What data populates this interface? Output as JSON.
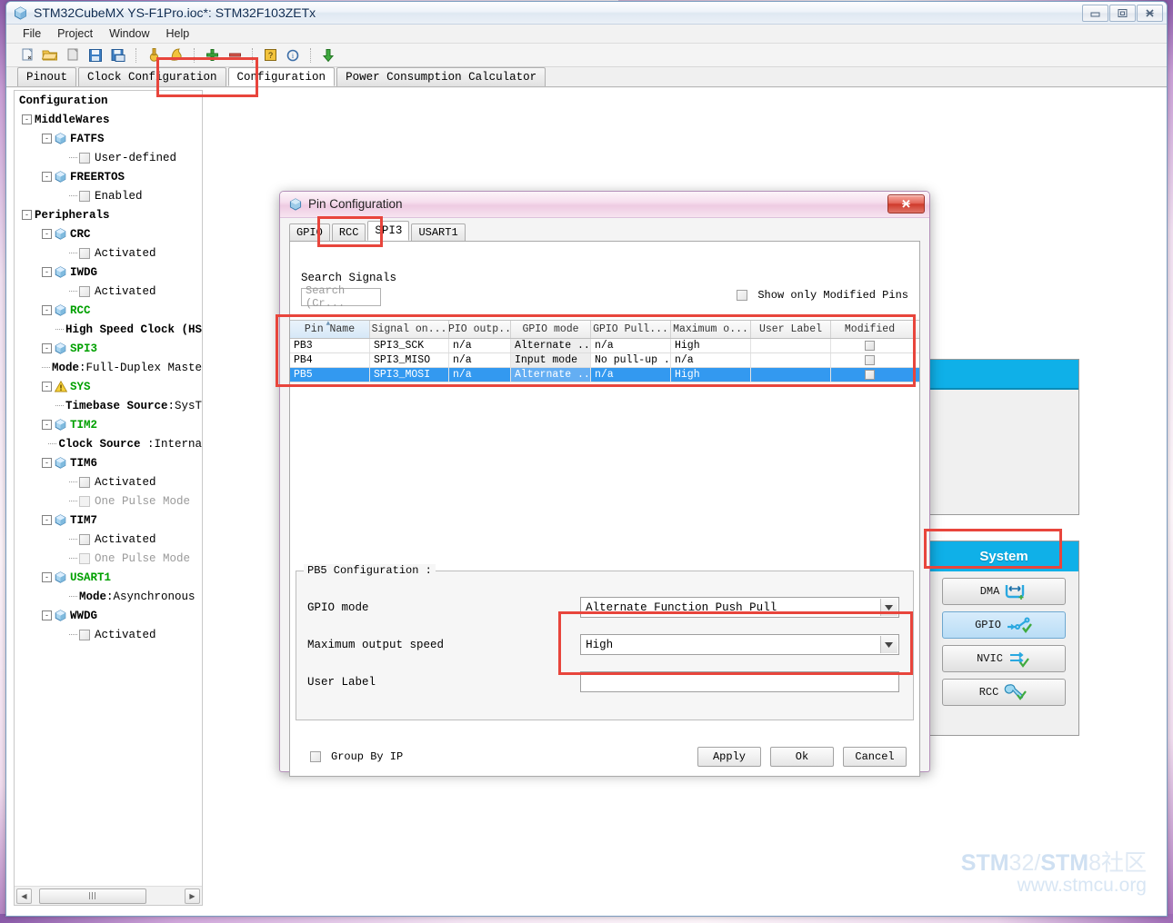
{
  "window": {
    "title": "STM32CubeMX YS-F1Pro.ioc*: STM32F103ZETx",
    "app_icon": "cube-icon",
    "controls": {
      "minimize": "minimize-icon",
      "maximize": "maximize-icon",
      "close": "close-icon"
    }
  },
  "menu": {
    "items": [
      "File",
      "Project",
      "Window",
      "Help"
    ]
  },
  "toolbar": {
    "buttons": [
      "new-project-icon",
      "open-project-icon",
      "copy-icon",
      "save-icon",
      "save-as-icon",
      "sep",
      "pin-icon",
      "generate-report-icon",
      "sep",
      "zoom-in-icon",
      "zoom-out-icon",
      "sep",
      "help-icon",
      "about-icon",
      "sep",
      "download-icon"
    ]
  },
  "main_tabs": {
    "items": [
      "Pinout",
      "Clock Configuration",
      "Configuration",
      "Power Consumption Calculator"
    ],
    "active": "Configuration"
  },
  "tree": {
    "title": "Configuration",
    "nodes": [
      {
        "id": "middlewares",
        "label": "MiddleWares",
        "indent": 8,
        "type": "group",
        "expander": "-"
      },
      {
        "id": "fatfs",
        "label": "FATFS",
        "indent": 30,
        "type": "peri",
        "expander": "-",
        "state": "normal"
      },
      {
        "id": "fatfs-ud",
        "label": "User-defined",
        "indent": 60,
        "type": "check",
        "checked": false,
        "enabled": true
      },
      {
        "id": "freertos",
        "label": "FREERTOS",
        "indent": 30,
        "type": "peri",
        "expander": "-",
        "state": "normal"
      },
      {
        "id": "freertos-en",
        "label": "Enabled",
        "indent": 60,
        "type": "check",
        "checked": false,
        "enabled": true
      },
      {
        "id": "peripherals",
        "label": "Peripherals",
        "indent": 8,
        "type": "group",
        "expander": "-"
      },
      {
        "id": "crc",
        "label": "CRC",
        "indent": 30,
        "type": "peri",
        "expander": "-",
        "state": "normal"
      },
      {
        "id": "crc-act",
        "label": "Activated",
        "indent": 60,
        "type": "check",
        "checked": false,
        "enabled": true
      },
      {
        "id": "iwdg",
        "label": "IWDG",
        "indent": 30,
        "type": "peri",
        "expander": "-",
        "state": "normal"
      },
      {
        "id": "iwdg-act",
        "label": "Activated",
        "indent": 60,
        "type": "check",
        "checked": false,
        "enabled": true
      },
      {
        "id": "rcc",
        "label": "RCC",
        "indent": 30,
        "type": "peri",
        "expander": "-",
        "state": "green"
      },
      {
        "id": "rcc-hs",
        "label": "High Speed Clock (HS",
        "indent": 60,
        "type": "sub"
      },
      {
        "id": "spi3",
        "label": "SPI3",
        "indent": 30,
        "type": "peri",
        "expander": "-",
        "state": "green"
      },
      {
        "id": "spi3-mode",
        "label": "Mode",
        "value": ":Full-Duplex Maste",
        "indent": 60,
        "type": "sub"
      },
      {
        "id": "sys",
        "label": "SYS",
        "indent": 30,
        "type": "warn",
        "expander": "-",
        "state": "green"
      },
      {
        "id": "sys-tb",
        "label": "Timebase Source",
        "value": ":SysT",
        "indent": 60,
        "type": "sub"
      },
      {
        "id": "tim2",
        "label": "TIM2",
        "indent": 30,
        "type": "peri",
        "expander": "-",
        "state": "green"
      },
      {
        "id": "tim2-clk",
        "label": "Clock Source",
        "value": " :Interna",
        "indent": 60,
        "type": "sub"
      },
      {
        "id": "tim6",
        "label": "TIM6",
        "indent": 30,
        "type": "peri",
        "expander": "-",
        "state": "normal"
      },
      {
        "id": "tim6-act",
        "label": "Activated",
        "indent": 60,
        "type": "check",
        "checked": false,
        "enabled": true
      },
      {
        "id": "tim6-opm",
        "label": "One Pulse Mode",
        "indent": 60,
        "type": "check",
        "checked": false,
        "enabled": false
      },
      {
        "id": "tim7",
        "label": "TIM7",
        "indent": 30,
        "type": "peri",
        "expander": "-",
        "state": "normal"
      },
      {
        "id": "tim7-act",
        "label": "Activated",
        "indent": 60,
        "type": "check",
        "checked": false,
        "enabled": true
      },
      {
        "id": "tim7-opm",
        "label": "One Pulse Mode",
        "indent": 60,
        "type": "check",
        "checked": false,
        "enabled": false
      },
      {
        "id": "usart1",
        "label": "USART1",
        "indent": 30,
        "type": "peri",
        "expander": "-",
        "state": "green"
      },
      {
        "id": "usart1-mode",
        "label": "Mode",
        "value": ":Asynchronous",
        "indent": 60,
        "type": "sub"
      },
      {
        "id": "wwdg",
        "label": "WWDG",
        "indent": 30,
        "type": "peri",
        "expander": "-",
        "state": "normal"
      },
      {
        "id": "wwdg-act",
        "label": "Activated",
        "indent": 60,
        "type": "check",
        "checked": false,
        "enabled": true
      }
    ]
  },
  "ip_panels": {
    "system": {
      "title": "System",
      "buttons": [
        {
          "label": "DMA",
          "icon": "dma-icon",
          "selected": false
        },
        {
          "label": "GPIO",
          "icon": "gpio-icon",
          "selected": true
        },
        {
          "label": "NVIC",
          "icon": "nvic-icon",
          "selected": false
        },
        {
          "label": "RCC",
          "icon": "rcc-wrench-icon",
          "selected": false
        }
      ]
    }
  },
  "dialog": {
    "title": "Pin Configuration",
    "icon": "cube-icon",
    "close_icon": "close-icon",
    "tabs": {
      "items": [
        "GPIO",
        "RCC",
        "SPI3",
        "USART1"
      ],
      "active": "SPI3"
    },
    "search": {
      "label": "Search Signals",
      "placeholder": "Search (Cr...",
      "value": ""
    },
    "show_modified": {
      "label": "Show only Modified Pins",
      "checked": false
    },
    "table": {
      "columns": [
        "Pin Name",
        "Signal on...",
        "GPIO outp...",
        "GPIO mode",
        "GPIO Pull...",
        "Maximum o...",
        "User Label",
        "Modified"
      ],
      "sorted_column": "Pin Name",
      "sort_direction": "asc",
      "rows": [
        {
          "pin": "PB3",
          "signal": "SPI3_SCK",
          "output": "n/a",
          "mode": "Alternate ...",
          "pull": "n/a",
          "speed": "High",
          "user_label": "",
          "modified": false,
          "selected": false
        },
        {
          "pin": "PB4",
          "signal": "SPI3_MISO",
          "output": "n/a",
          "mode": "Input mode",
          "pull": "No pull-up ...",
          "speed": "n/a",
          "user_label": "",
          "modified": false,
          "selected": false
        },
        {
          "pin": "PB5",
          "signal": "SPI3_MOSI",
          "output": "n/a",
          "mode": "Alternate ...",
          "pull": "n/a",
          "speed": "High",
          "user_label": "",
          "modified": false,
          "selected": true
        }
      ]
    },
    "config": {
      "legend": "PB5 Configuration :",
      "gpio_mode": {
        "label": "GPIO mode",
        "value": "Alternate Function Push Pull"
      },
      "max_speed": {
        "label": "Maximum output speed",
        "value": "High"
      },
      "user_label": {
        "label": "User Label",
        "value": ""
      }
    },
    "footer": {
      "group_by_ip": {
        "label": "Group By IP",
        "checked": false
      },
      "buttons": [
        "Apply",
        "Ok",
        "Cancel"
      ]
    }
  },
  "watermark": {
    "line1_bold1": "STM",
    "line1_lite1": "32/",
    "line1_bold2": "STM",
    "line1_lite2": "8社区",
    "line2": "www.stmcu.org"
  },
  "colors": {
    "accent": "#0fb0e8",
    "selection": "#3399f0",
    "green": "#00a000",
    "annotation": "#e8453c"
  }
}
